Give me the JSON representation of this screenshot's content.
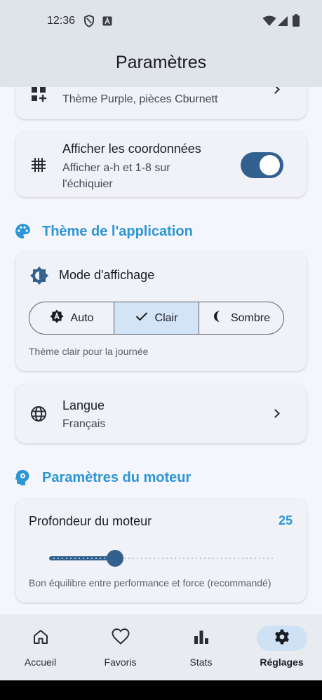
{
  "status_bar": {
    "time": "12:36",
    "icons": [
      "shield-icon",
      "a-badge-icon",
      "wifi-icon",
      "signal-icon",
      "battery-icon"
    ]
  },
  "app_bar": {
    "title": "Paramètres"
  },
  "board_card": {
    "icon": "grid-add-icon",
    "subtitle": "Thème Purple, pièces Cburnett"
  },
  "coords_card": {
    "icon": "grid-icon",
    "title": "Afficher les coordonnées",
    "subtitle_line1": "Afficher a-h et 1-8 sur",
    "subtitle_line2": "l'échiquier",
    "toggle_on": true
  },
  "theme_section": {
    "icon": "palette-icon",
    "title": "Thème de l'application"
  },
  "display_mode": {
    "icon": "brightness-icon",
    "title": "Mode d'affichage",
    "options": [
      {
        "label": "Auto",
        "icon": "auto-mode-icon",
        "selected": false
      },
      {
        "label": "Clair",
        "icon": "check-icon",
        "selected": true
      },
      {
        "label": "Sombre",
        "icon": "moon-icon",
        "selected": false
      }
    ],
    "description": "Thème clair pour la journée"
  },
  "language": {
    "icon": "globe-icon",
    "title": "Langue",
    "value": "Français"
  },
  "engine_section": {
    "icon": "engine-head-icon",
    "title": "Paramètres du moteur"
  },
  "engine_depth": {
    "title": "Profondeur du moteur",
    "value": "25",
    "slider_fraction": 0.29,
    "description": "Bon équilibre entre performance et force (recommandé)"
  },
  "bottom_nav": [
    {
      "label": "Accueil",
      "icon": "home-icon",
      "active": false
    },
    {
      "label": "Favoris",
      "icon": "heart-icon",
      "active": false
    },
    {
      "label": "Stats",
      "icon": "bar-chart-icon",
      "active": false
    },
    {
      "label": "Réglages",
      "icon": "gear-icon",
      "active": true
    }
  ],
  "colors": {
    "accent": "#2b95d6",
    "primary": "#33618f",
    "selected_segment": "#d3e4f7"
  }
}
